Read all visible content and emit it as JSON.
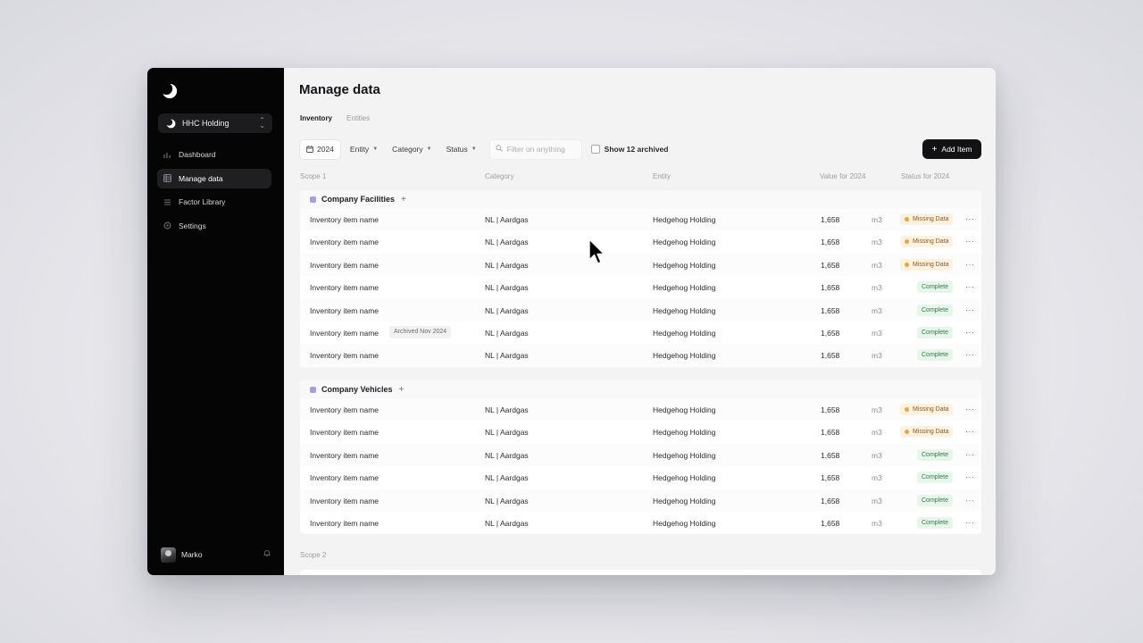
{
  "sidebar": {
    "org_name": "HHC Holding",
    "nav": [
      {
        "label": "Dashboard",
        "icon": "dashboard-icon",
        "active": false
      },
      {
        "label": "Manage data",
        "icon": "table-icon",
        "active": true
      },
      {
        "label": "Factor Library",
        "icon": "library-icon",
        "active": false
      },
      {
        "label": "Settings",
        "icon": "gear-icon",
        "active": false
      }
    ],
    "user_name": "Marko"
  },
  "main": {
    "title": "Manage data",
    "tabs": [
      {
        "label": "Inventory",
        "active": true
      },
      {
        "label": "Entities",
        "active": false
      }
    ],
    "filters": {
      "year": "2024",
      "entity": "Entity",
      "category": "Category",
      "status": "Status",
      "search_placeholder": "Filter on anything",
      "archived_label": "Show 12 archived",
      "add_button": "Add Item"
    },
    "columns": {
      "scope": "Scope 1",
      "category": "Category",
      "entity": "Entity",
      "value": "Value for 2024",
      "status": "Status for 2024"
    },
    "groups": [
      {
        "name": "Company Facilities",
        "rows": [
          {
            "name": "Inventory item name",
            "category": "NL | Aardgas",
            "entity": "Hedgehog Holding",
            "value": "1,658",
            "unit": "m3",
            "status": "Missing Data",
            "archived": ""
          },
          {
            "name": "Inventory item name",
            "category": "NL | Aardgas",
            "entity": "Hedgehog Holding",
            "value": "1,658",
            "unit": "m3",
            "status": "Missing Data",
            "archived": ""
          },
          {
            "name": "Inventory item name",
            "category": "NL | Aardgas",
            "entity": "Hedgehog Holding",
            "value": "1,658",
            "unit": "m3",
            "status": "Missing Data",
            "archived": ""
          },
          {
            "name": "Inventory item name",
            "category": "NL | Aardgas",
            "entity": "Hedgehog Holding",
            "value": "1,658",
            "unit": "m3",
            "status": "Complete",
            "archived": ""
          },
          {
            "name": "Inventory item name",
            "category": "NL | Aardgas",
            "entity": "Hedgehog Holding",
            "value": "1,658",
            "unit": "m3",
            "status": "Complete",
            "archived": ""
          },
          {
            "name": "Inventory item name",
            "category": "NL | Aardgas",
            "entity": "Hedgehog Holding",
            "value": "1,658",
            "unit": "m3",
            "status": "Complete",
            "archived": "Archived Nov 2024"
          },
          {
            "name": "Inventory item name",
            "category": "NL | Aardgas",
            "entity": "Hedgehog Holding",
            "value": "1,658",
            "unit": "m3",
            "status": "Complete",
            "archived": ""
          }
        ]
      },
      {
        "name": "Company Vehicles",
        "rows": [
          {
            "name": "Inventory item name",
            "category": "NL | Aardgas",
            "entity": "Hedgehog Holding",
            "value": "1,658",
            "unit": "m3",
            "status": "Missing Data",
            "archived": ""
          },
          {
            "name": "Inventory item name",
            "category": "NL | Aardgas",
            "entity": "Hedgehog Holding",
            "value": "1,658",
            "unit": "m3",
            "status": "Missing Data",
            "archived": ""
          },
          {
            "name": "Inventory item name",
            "category": "NL | Aardgas",
            "entity": "Hedgehog Holding",
            "value": "1,658",
            "unit": "m3",
            "status": "Complete",
            "archived": ""
          },
          {
            "name": "Inventory item name",
            "category": "NL | Aardgas",
            "entity": "Hedgehog Holding",
            "value": "1,658",
            "unit": "m3",
            "status": "Complete",
            "archived": ""
          },
          {
            "name": "Inventory item name",
            "category": "NL | Aardgas",
            "entity": "Hedgehog Holding",
            "value": "1,658",
            "unit": "m3",
            "status": "Complete",
            "archived": ""
          },
          {
            "name": "Inventory item name",
            "category": "NL | Aardgas",
            "entity": "Hedgehog Holding",
            "value": "1,658",
            "unit": "m3",
            "status": "Complete",
            "archived": ""
          }
        ]
      }
    ],
    "scope2_label": "Scope 2"
  },
  "colors": {
    "sidebar_bg": "#050505",
    "accent_swatch": "#a79bea",
    "missing_bg": "#fdf1e1",
    "missing_dot": "#f0a53a",
    "complete_bg": "#e6f6ea",
    "complete_text": "#2f7d44",
    "primary_button": "#121214"
  }
}
